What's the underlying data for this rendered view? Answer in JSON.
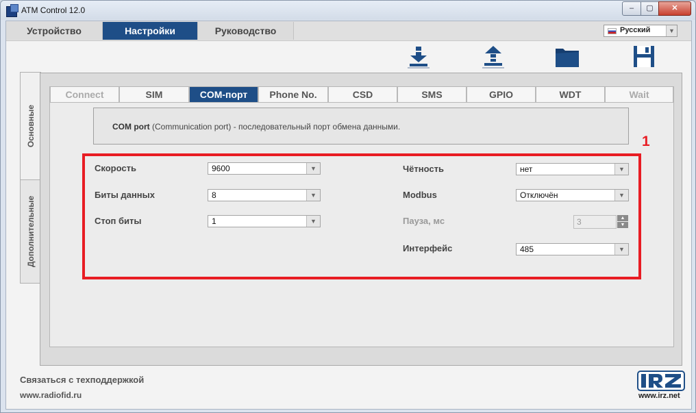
{
  "window": {
    "title": "ATM Control 12.0",
    "min": "–",
    "max": "▢",
    "close": "✕"
  },
  "main_tabs": [
    {
      "label": "Устройство",
      "active": false
    },
    {
      "label": "Настройки",
      "active": true
    },
    {
      "label": "Руководство",
      "active": false
    }
  ],
  "language": {
    "label": "Русский",
    "arrow": "▼"
  },
  "toolbar": [
    {
      "name": "download-icon"
    },
    {
      "name": "upload-icon"
    },
    {
      "name": "folder-icon"
    },
    {
      "name": "save-icon"
    }
  ],
  "side_tabs": [
    "Основные",
    "Дополнительные"
  ],
  "sub_tabs": [
    {
      "label": "Connect",
      "state": "disabled"
    },
    {
      "label": "SIM",
      "state": "normal"
    },
    {
      "label": "COM-порт",
      "state": "active"
    },
    {
      "label": "Phone No.",
      "state": "normal"
    },
    {
      "label": "CSD",
      "state": "normal"
    },
    {
      "label": "SMS",
      "state": "normal"
    },
    {
      "label": "GPIO",
      "state": "normal"
    },
    {
      "label": "WDT",
      "state": "normal"
    },
    {
      "label": "Wait",
      "state": "disabled"
    }
  ],
  "info": {
    "bold": "COM port",
    "text": " (Communication port) - последовательный порт обмена данными."
  },
  "annotation_marker": "1",
  "fields_left": [
    {
      "label": "Скорость",
      "value": "9600"
    },
    {
      "label": "Биты данных",
      "value": "8"
    },
    {
      "label": "Стоп биты",
      "value": "1"
    }
  ],
  "fields_right": {
    "parity": {
      "label": "Чётность",
      "value": "нет"
    },
    "modbus": {
      "label": "Modbus",
      "value": "Отключён"
    },
    "pause": {
      "label": "Пауза, мс",
      "value": "3"
    },
    "interface": {
      "label": "Интерфейс",
      "value": "485"
    }
  },
  "arrow": "▼",
  "stepper_up": "▲",
  "stepper_down": "▼",
  "footer": {
    "support": "Связаться с техподдержкой",
    "site": "www.radiofid.ru"
  },
  "brand": {
    "logo_text": "iRZ",
    "url": "www.irz.net"
  },
  "colors": {
    "active_tab": "#1e4e87",
    "highlight": "#e81c23"
  }
}
